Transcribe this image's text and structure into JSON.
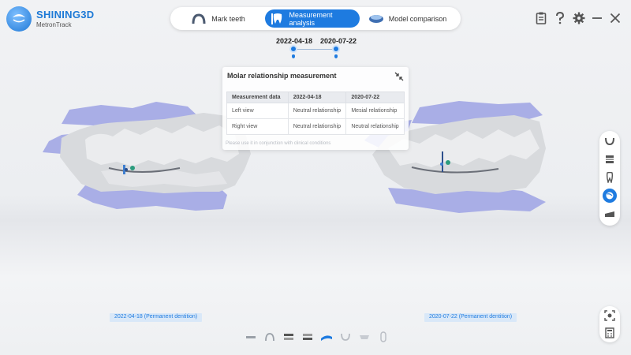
{
  "app": {
    "brand": "SHINING3D",
    "product": "MetronTrack"
  },
  "tabs": [
    {
      "label": "Mark teeth",
      "active": false
    },
    {
      "label": "Measurement analysis",
      "active": true
    },
    {
      "label": "Model comparison",
      "active": false
    }
  ],
  "window_controls": [
    "report-icon",
    "help-icon",
    "settings-icon",
    "minimize-icon",
    "close-icon"
  ],
  "timeline": {
    "dates": [
      "2022-04-18",
      "2020-07-22"
    ]
  },
  "panel": {
    "title": "Molar relationship measurement",
    "columns": [
      "Measurement data",
      "2022-04-18",
      "2020-07-22"
    ],
    "rows": [
      [
        "Left view",
        "Neutral relationship",
        "Mesial relationship"
      ],
      [
        "Right view",
        "Neutral relationship",
        "Neutral relationship"
      ]
    ],
    "note": "Please use it in conjunction with clinical conditions"
  },
  "model_labels": [
    "2022-04-18 (Permanent dentition)",
    "2020-07-22 (Permanent dentition)"
  ],
  "right_toolbar": [
    "arch-icon",
    "occlusal-layers-icon",
    "tooth-icon",
    "cut-view-icon",
    "section-icon"
  ],
  "right_toolbar_active": "cut-view-icon",
  "bottom_toolbar": [
    "front-view-icon",
    "arch-view-icon",
    "layer-view-icon",
    "layer-view-2-icon",
    "occlusal-view-icon",
    "lower-arch-icon",
    "upper-arch-icon",
    "side-view-icon"
  ],
  "colors": {
    "accent": "#1e7be0",
    "gum": "#a9aee6",
    "teeth": "#d8dadd"
  }
}
